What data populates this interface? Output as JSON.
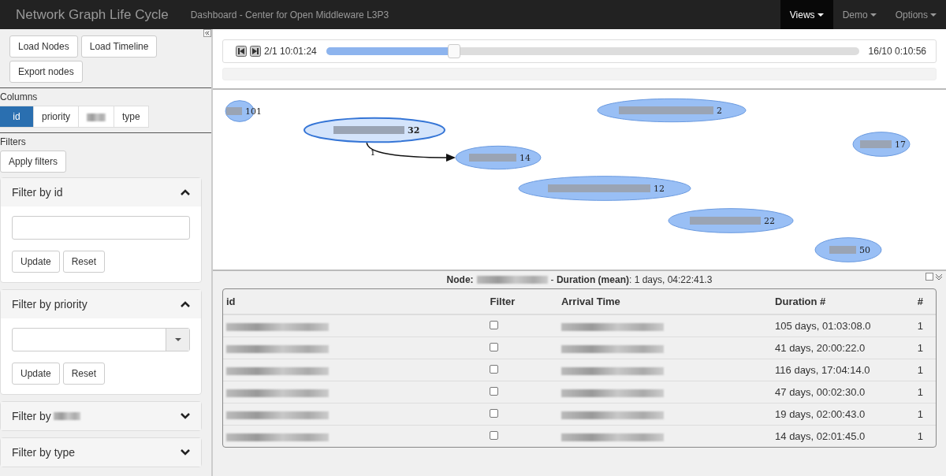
{
  "navbar": {
    "brand": "Network Graph Life Cycle",
    "subtitle": "Dashboard - Center for Open Middleware L3P3",
    "menus": [
      {
        "label": "Views",
        "selected": true
      },
      {
        "label": "Demo",
        "selected": false
      },
      {
        "label": "Options",
        "selected": false
      }
    ]
  },
  "sidebar": {
    "buttons": [
      "Load Nodes",
      "Load Timeline",
      "Export nodes"
    ],
    "columns_label": "Columns",
    "columns": [
      {
        "label": "id",
        "selected": true
      },
      {
        "label": "priority",
        "selected": false
      },
      {
        "redacted": true,
        "selected": false
      },
      {
        "label": "type",
        "selected": false
      }
    ],
    "filters_label": "Filters",
    "apply": "Apply filters",
    "panels": [
      {
        "title": "Filter by id",
        "expanded": true,
        "kind": "text",
        "buttons": [
          "Update",
          "Reset"
        ]
      },
      {
        "title": "Filter by priority",
        "expanded": true,
        "kind": "select",
        "buttons": [
          "Update",
          "Reset"
        ]
      },
      {
        "title": "Filter by",
        "title_redacted": true,
        "expanded": false
      },
      {
        "title": "Filter by type",
        "expanded": false
      }
    ]
  },
  "timeline": {
    "start": "2/1 10:01:24",
    "end": "16/10 0:10:56",
    "level": 0.24
  },
  "progress": {
    "level": 0
  },
  "graph": {
    "nodes": [
      {
        "number": "101",
        "selected": false
      },
      {
        "number": "32",
        "selected": true
      },
      {
        "number": "14",
        "selected": false
      },
      {
        "number": "2",
        "selected": false
      },
      {
        "number": "17",
        "selected": false
      },
      {
        "number": "12",
        "selected": false
      },
      {
        "number": "22",
        "selected": false
      },
      {
        "number": "50",
        "selected": false
      }
    ],
    "edges": [
      {
        "label": "1"
      }
    ]
  },
  "details": {
    "node_label": "Node:",
    "summary": "- **Duration (mean)**: 1 days, 04:22:41.3"
  },
  "table": {
    "columns": [
      "id",
      "Filter",
      "Arrival Time",
      "Duration #",
      "#"
    ],
    "rows": [
      {
        "checked": false,
        "duration": "105 days, 01:03:08.0",
        "count": "1"
      },
      {
        "checked": false,
        "duration": "41 days, 20:00:22.0",
        "count": "1"
      },
      {
        "checked": false,
        "duration": "116 days, 17:04:14.0",
        "count": "1"
      },
      {
        "checked": false,
        "duration": "47 days, 00:02:30.0",
        "count": "1"
      },
      {
        "checked": false,
        "duration": "19 days, 02:00:43.0",
        "count": "1"
      },
      {
        "checked": false,
        "duration": "14 days, 02:01:45.0",
        "count": "1"
      }
    ]
  }
}
